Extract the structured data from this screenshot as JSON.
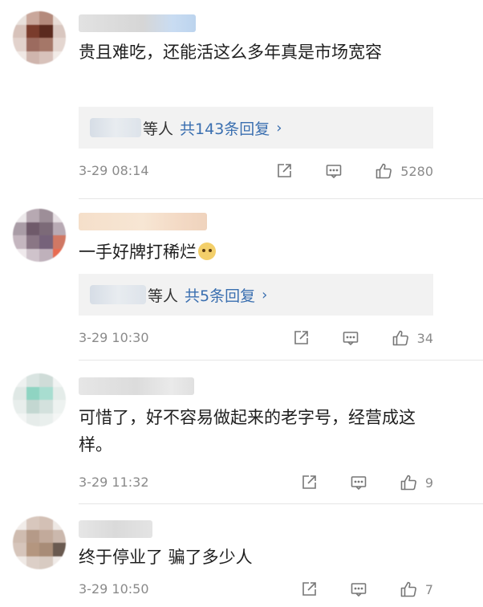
{
  "comments": [
    {
      "text": "贵且难吃，还能活这么多年真是市场宽容",
      "reply": {
        "suffix": "等人",
        "count_label": "共143条回复",
        "chevron": "›"
      },
      "time": "3-29 08:14",
      "likes": "5280",
      "icons": {
        "share": "share-icon",
        "comment": "comment-icon",
        "like": "thumbs-up-icon"
      }
    },
    {
      "text": "一手好牌打稀烂",
      "emoji": "dog-face-emoji",
      "reply": {
        "suffix": "等人",
        "count_label": "共5条回复",
        "chevron": "›"
      },
      "time": "3-29 10:30",
      "likes": "34",
      "icons": {
        "share": "share-icon",
        "comment": "comment-icon",
        "like": "thumbs-up-icon"
      }
    },
    {
      "text": "可惜了，好不容易做起来的老字号，经营成这样。",
      "time": "3-29 11:32",
      "likes": "9",
      "icons": {
        "share": "share-icon",
        "comment": "comment-icon",
        "like": "thumbs-up-icon"
      }
    },
    {
      "text": "终于停业了 骗了多少人",
      "time": "3-29 10:50",
      "likes": "7",
      "icons": {
        "share": "share-icon",
        "comment": "comment-icon",
        "like": "thumbs-up-icon"
      }
    }
  ],
  "colors": {
    "reply_link": "#3a6fb0",
    "meta_text": "#8a8a8a",
    "reply_bg": "#f2f2f2"
  }
}
